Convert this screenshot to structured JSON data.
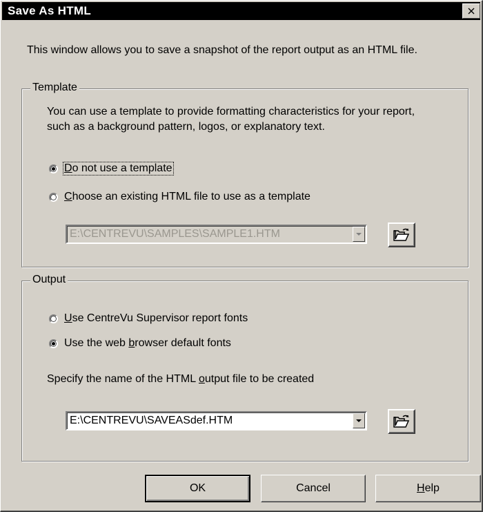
{
  "window": {
    "title": "Save As HTML",
    "close_glyph": "✕"
  },
  "intro": "This window allows you to save a snapshot of the report output as an HTML file.",
  "template": {
    "label": "Template",
    "description_line1": "You can use a template to provide formatting characteristics for your report,",
    "description_line2": "such as a background pattern, logos, or explanatory text.",
    "option_none": {
      "accel": "D",
      "rest": "o not use a template",
      "selected": true
    },
    "option_existing": {
      "accel": "C",
      "rest": "hoose an existing HTML file to use as a template",
      "selected": false
    },
    "path": "E:\\CENTREVU\\SAMPLES\\SAMPLE1.HTM",
    "path_enabled": false
  },
  "output": {
    "label": "Output",
    "option_centrevu": {
      "pre": "",
      "accel": "U",
      "rest": "se CentreVu Supervisor report fonts",
      "selected": false
    },
    "option_browser": {
      "pre": "Use the web ",
      "accel": "b",
      "rest": "rowser default fonts",
      "selected": true
    },
    "specify_pre": "Specify the name of the HTML ",
    "specify_accel": "o",
    "specify_rest": "utput file to be created",
    "path": "E:\\CENTREVU\\SAVEASdef.HTM"
  },
  "buttons": {
    "ok": "OK",
    "cancel": "Cancel",
    "help_accel": "H",
    "help_rest": "elp"
  },
  "icons": {
    "close": "close-icon",
    "dropdown": "chevron-down-icon",
    "browse": "open-folder-icon"
  }
}
